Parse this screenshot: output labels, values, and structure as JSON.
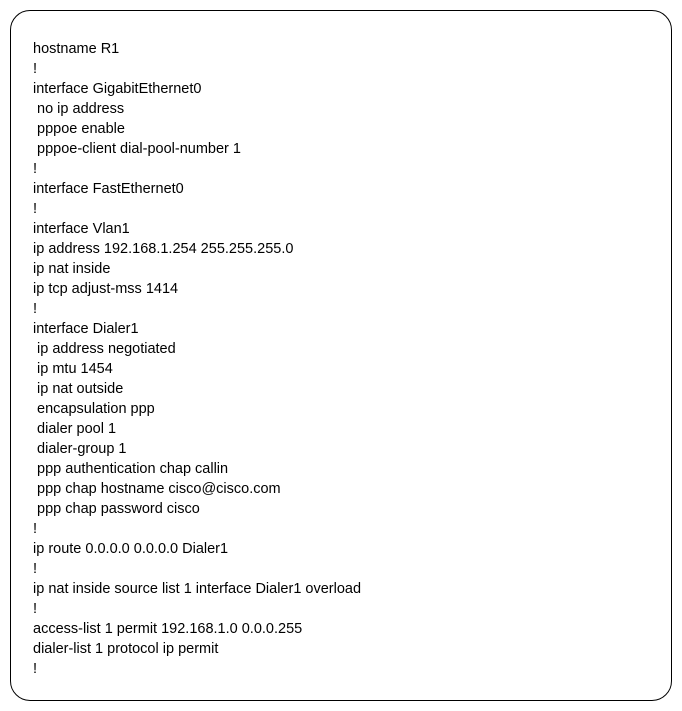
{
  "config": {
    "lines": [
      "hostname R1",
      "!",
      "interface GigabitEthernet0",
      " no ip address",
      " pppoe enable",
      " pppoe-client dial-pool-number 1",
      "!",
      "interface FastEthernet0",
      "!",
      "interface Vlan1",
      "ip address 192.168.1.254 255.255.255.0",
      "ip nat inside",
      "ip tcp adjust-mss 1414",
      "!",
      "interface Dialer1",
      " ip address negotiated",
      " ip mtu 1454",
      " ip nat outside",
      " encapsulation ppp",
      " dialer pool 1",
      " dialer-group 1",
      " ppp authentication chap callin",
      " ppp chap hostname cisco@cisco.com",
      " ppp chap password cisco",
      "!",
      "ip route 0.0.0.0 0.0.0.0 Dialer1",
      "!",
      "ip nat inside source list 1 interface Dialer1 overload",
      "!",
      "access-list 1 permit 192.168.1.0 0.0.0.255",
      "dialer-list 1 protocol ip permit",
      "!"
    ]
  }
}
